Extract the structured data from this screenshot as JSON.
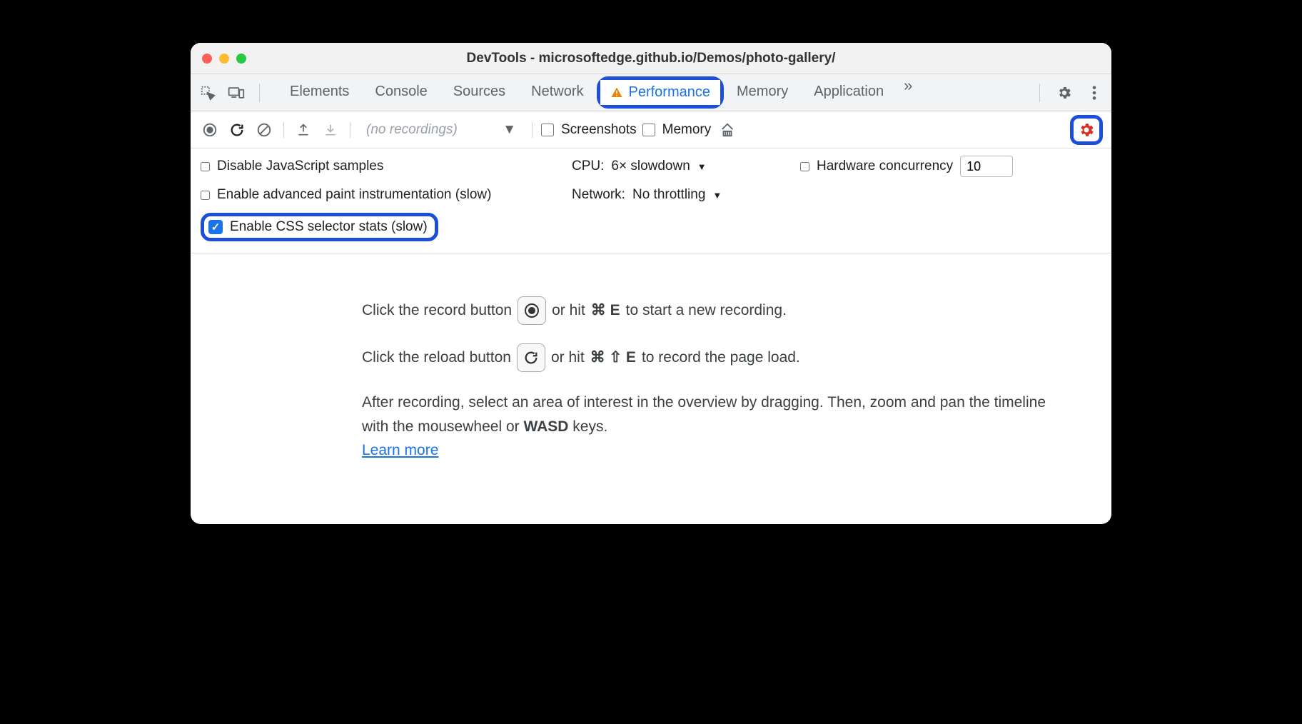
{
  "window": {
    "title": "DevTools - microsoftedge.github.io/Demos/photo-gallery/"
  },
  "tabs": {
    "items": [
      "Elements",
      "Console",
      "Sources",
      "Network",
      "Performance",
      "Memory",
      "Application"
    ],
    "active": "Performance",
    "overflow": "»"
  },
  "toolbar": {
    "recordings_placeholder": "(no recordings)",
    "screenshots_label": "Screenshots",
    "memory_label": "Memory"
  },
  "settings": {
    "disable_js_label": "Disable JavaScript samples",
    "cpu_label": "CPU:",
    "cpu_value": "6× slowdown",
    "hw_label": "Hardware concurrency",
    "hw_value": "10",
    "paint_label": "Enable advanced paint instrumentation (slow)",
    "network_label": "Network:",
    "network_value": "No throttling",
    "css_stats_label": "Enable CSS selector stats (slow)"
  },
  "empty": {
    "line1a": "Click the record button",
    "line1b": "or hit",
    "line1_shortcut": "⌘ E",
    "line1c": "to start a new recording.",
    "line2a": "Click the reload button",
    "line2b": "or hit",
    "line2_shortcut": "⌘ ⇧ E",
    "line2c": "to record the page load.",
    "line3": "After recording, select an area of interest in the overview by dragging. Then, zoom and pan the timeline with the mousewheel or ",
    "wasd": "WASD",
    "line3b": " keys.",
    "learn_more": "Learn more"
  }
}
